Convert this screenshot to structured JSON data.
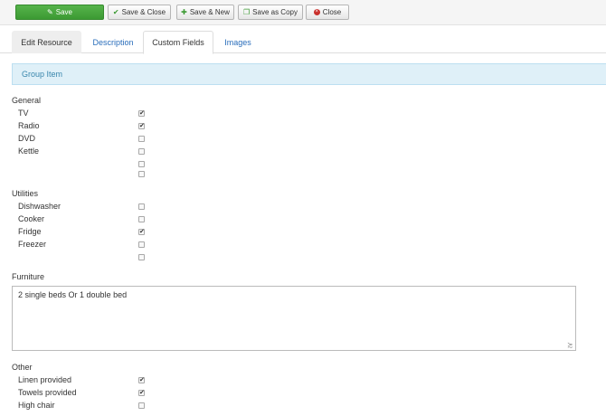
{
  "toolbar": {
    "save": "Save",
    "save_close": "Save & Close",
    "save_new": "Save & New",
    "save_copy": "Save as Copy",
    "close": "Close"
  },
  "tabs": [
    "Edit Resource",
    "Description",
    "Custom Fields",
    "Images"
  ],
  "active_tab": "Custom Fields",
  "banner": "Group Item",
  "general": {
    "label": "General",
    "items": [
      {
        "label": "TV",
        "checked": true
      },
      {
        "label": "Radio",
        "checked": true
      },
      {
        "label": "DVD",
        "checked": false
      },
      {
        "label": "Kettle",
        "checked": false
      },
      {
        "label": "",
        "checked": false
      },
      {
        "label": "",
        "checked": false
      }
    ]
  },
  "utilities": {
    "label": "Utilities",
    "items": [
      {
        "label": "Dishwasher",
        "checked": false
      },
      {
        "label": "Cooker",
        "checked": false
      },
      {
        "label": "Fridge",
        "checked": true
      },
      {
        "label": "Freezer",
        "checked": false
      },
      {
        "label": "",
        "checked": false
      }
    ]
  },
  "furniture": {
    "label": "Furniture",
    "value": "2 single beds Or 1 double bed"
  },
  "other": {
    "label": "Other",
    "items": [
      {
        "label": "Linen provided",
        "checked": true
      },
      {
        "label": "Towels provided",
        "checked": true
      },
      {
        "label": "High chair",
        "checked": false
      }
    ]
  },
  "colors": {
    "save_button": "#3c9a33",
    "banner_bg": "#dff0f8",
    "link": "#2a6ebb"
  }
}
